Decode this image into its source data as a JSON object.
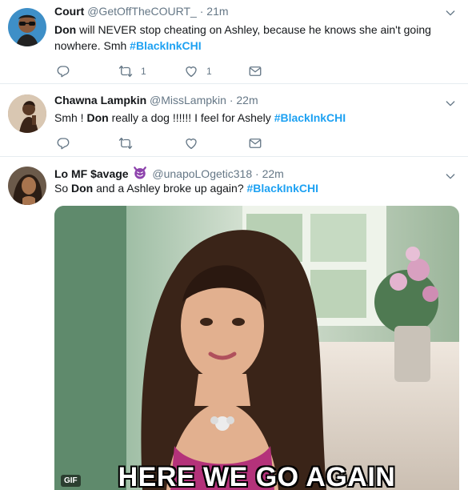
{
  "tweets": [
    {
      "name": "Court",
      "handle": "@GetOffTheCOURT_",
      "separator": "·",
      "time": "21m",
      "text_parts": [
        "Don",
        " will NEVER stop cheating on Ashley, because he knows she ain't going nowhere. Smh "
      ],
      "hashtag": "#BlackInkCHI",
      "retweets": "1",
      "likes": "1"
    },
    {
      "name": "Chawna Lampkin",
      "handle": "@MissLampkin",
      "separator": "·",
      "time": "22m",
      "text_parts": [
        "Smh ! ",
        "Don",
        " really a dog !!!!!! I feel for Ashely "
      ],
      "hashtag": "#BlackInkCHI",
      "retweets": "",
      "likes": ""
    },
    {
      "name": "Lo MF $avage",
      "handle": "@unapoLOgetic318",
      "separator": "·",
      "time": "22m",
      "text_parts": [
        "So ",
        "Don",
        " and a Ashley broke up again? "
      ],
      "hashtag": "#BlackInkCHI",
      "media_caption": "HERE WE GO AGAIN",
      "media_badge": "GIF"
    }
  ],
  "icons": {
    "reply": "reply-icon",
    "retweet": "retweet-icon",
    "like": "heart-icon",
    "dm": "envelope-icon",
    "more": "chevron-down-icon",
    "emoji": "smiling-imp-emoji"
  },
  "colors": {
    "link": "#1da1f2",
    "secondary": "#657786",
    "divider": "#e6ecf0",
    "emoji_purple": "#8e44ad"
  }
}
